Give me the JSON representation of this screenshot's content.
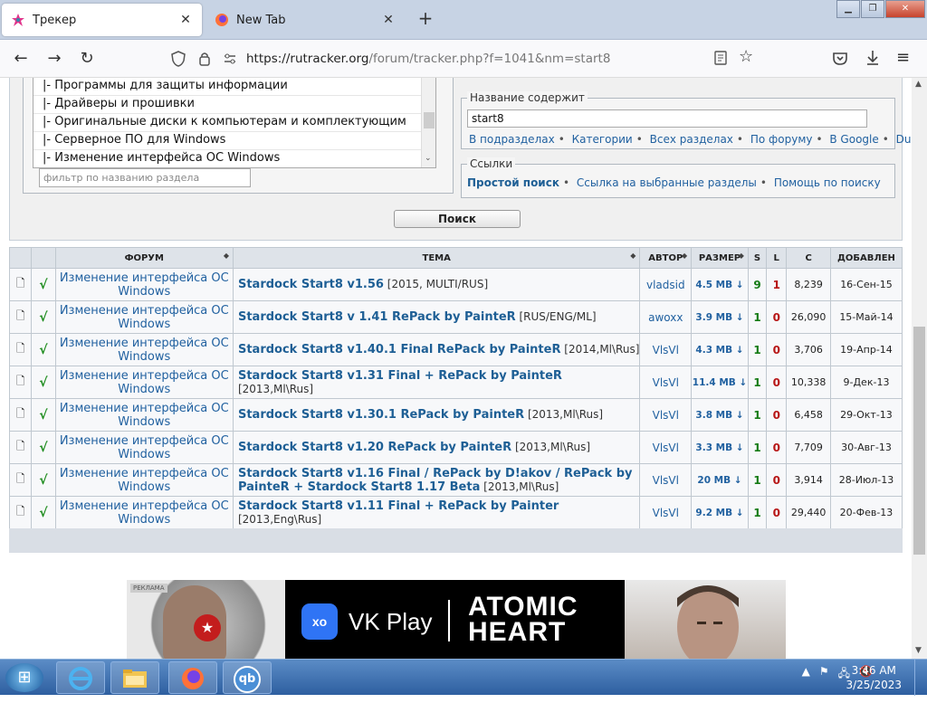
{
  "browser": {
    "tabs": [
      {
        "label": "Трекер",
        "active": true
      },
      {
        "label": "New Tab",
        "active": false
      }
    ],
    "url_domain": "https://rutracker.org",
    "url_path": "/forum/tracker.php?f=1041&nm=start8"
  },
  "search_form": {
    "categories": [
      "|- Программы для защиты информации",
      "|- Драйверы и прошивки",
      "|- Оригинальные диски к компьютерам и комплектующим",
      "|- Серверное ПО для Windows",
      "|- Изменение интерфейса ОС Windows"
    ],
    "filter_placeholder": "фильтр по названию раздела",
    "title_contains_legend": "Название содержит",
    "query": "start8",
    "scope_links": [
      "В подразделах",
      "Категории",
      "Всех разделах",
      "По форуму",
      "В Google",
      "Duck"
    ],
    "links_legend": "Ссылки",
    "simple_search": "Простой поиск",
    "selected_sections_link": "Ссылка на выбранные разделы",
    "search_help": "Помощь по поиску",
    "search_button": "Поиск"
  },
  "results": {
    "headers": {
      "forum": "ФОРУМ",
      "topic": "ТЕМА",
      "author": "АВТОР",
      "size": "РАЗМЕР",
      "seeds": "S",
      "leechers": "L",
      "completed": "C",
      "added": "ДОБАВЛЕН"
    },
    "rows": [
      {
        "forum": "Изменение интерфейса ОС Windows",
        "title": "Stardock Start8 v1.56",
        "tags": " [2015, MULTI/RUS]",
        "author": "vladsid",
        "size": "4.5 MB ↓",
        "seeds": "9",
        "leechers": "1",
        "completed": "8,239",
        "added": "16-Сен-15"
      },
      {
        "forum": "Изменение интерфейса ОС Windows",
        "title": "Stardock Start8 v 1.41 RePack by PainteR",
        "tags": " [RUS/ENG/ML]",
        "author": "awoxx",
        "size": "3.9 MB ↓",
        "seeds": "1",
        "leechers": "0",
        "completed": "26,090",
        "added": "15-Май-14"
      },
      {
        "forum": "Изменение интерфейса ОС Windows",
        "title": "Stardock Start8 v1.40.1 Final RePack by PainteR",
        "tags": " [2014,Ml\\Rus]",
        "author": "VlsVl",
        "size": "4.3 MB ↓",
        "seeds": "1",
        "leechers": "0",
        "completed": "3,706",
        "added": "19-Апр-14"
      },
      {
        "forum": "Изменение интерфейса ОС Windows",
        "title": "Stardock Start8 v1.31 Final + RePack by PainteR",
        "tags": " [2013,Ml\\Rus]",
        "author": "VlsVl",
        "size": "11.4 MB ↓",
        "seeds": "1",
        "leechers": "0",
        "completed": "10,338",
        "added": "9-Дек-13"
      },
      {
        "forum": "Изменение интерфейса ОС Windows",
        "title": "Stardock Start8 v1.30.1 RePack by PainteR",
        "tags": " [2013,Ml\\Rus]",
        "author": "VlsVl",
        "size": "3.8 MB ↓",
        "seeds": "1",
        "leechers": "0",
        "completed": "6,458",
        "added": "29-Окт-13"
      },
      {
        "forum": "Изменение интерфейса ОС Windows",
        "title": "Stardock Start8 v1.20 RePack by PainteR",
        "tags": " [2013,Ml\\Rus]",
        "author": "VlsVl",
        "size": "3.3 MB ↓",
        "seeds": "1",
        "leechers": "0",
        "completed": "7,709",
        "added": "30-Авг-13"
      },
      {
        "forum": "Изменение интерфейса ОС Windows",
        "title": "Stardock Start8 v1.16 Final / RePack by D!akov / RePack by PainteR + Stardock Start8 1.17 Beta",
        "tags": " [2013,Ml\\Rus]",
        "author": "VlsVl",
        "size": "20 MB ↓",
        "seeds": "1",
        "leechers": "0",
        "completed": "3,914",
        "added": "28-Июл-13"
      },
      {
        "forum": "Изменение интерфейса ОС Windows",
        "title": "Stardock Start8 v1.11 Final + RePack by Painter",
        "tags": " [2013,Eng\\Rus]",
        "author": "VlsVl",
        "size": "9.2 MB ↓",
        "seeds": "1",
        "leechers": "0",
        "completed": "29,440",
        "added": "20-Фев-13"
      }
    ]
  },
  "ad": {
    "badge": "РЕКЛАМА",
    "brand": "VK Play",
    "logo": "xo",
    "game": "ATOMIC HEART"
  },
  "taskbar": {
    "time": "3:46 AM",
    "date": "3/25/2023",
    "apps": [
      "internet-explorer-icon",
      "file-explorer-icon",
      "firefox-icon",
      "qbittorrent-icon"
    ],
    "qb_label": "qb"
  },
  "icons": {
    "back": "←",
    "forward": "→",
    "reload": "↻",
    "check": "√",
    "file": "🗋",
    "close": "✕",
    "plus": "+",
    "sort": "◆",
    "star": "☆",
    "menu": "≡"
  }
}
